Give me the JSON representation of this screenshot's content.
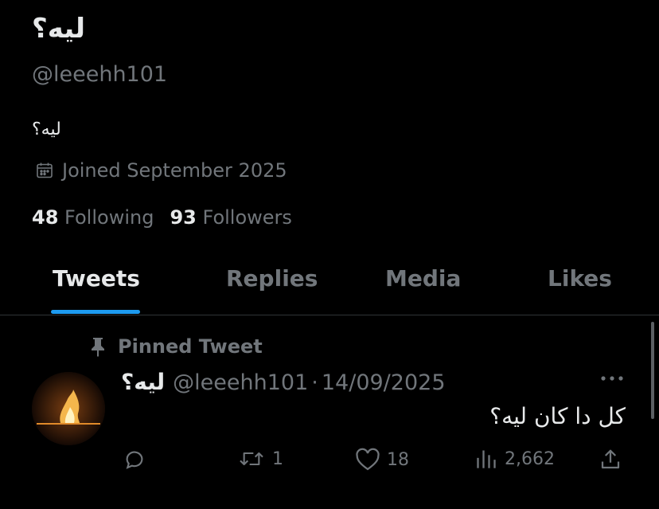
{
  "profile": {
    "display_name": "ليه؟",
    "handle": "@leeehh101",
    "bio": "ليه؟",
    "joined": "Joined September 2025",
    "following_count": "48",
    "following_label": "Following",
    "followers_count": "93",
    "followers_label": "Followers"
  },
  "tabs": [
    {
      "label": "Tweets",
      "active": true
    },
    {
      "label": "Replies",
      "active": false
    },
    {
      "label": "Media",
      "active": false
    },
    {
      "label": "Likes",
      "active": false
    }
  ],
  "pinned_tweet": {
    "pinned_label": "Pinned Tweet",
    "author_name": "ليه؟",
    "author_handle": "@leeehh101",
    "separator": "·",
    "date": "14/09/2025",
    "text": "كل دا كان ليه؟",
    "reply_count": "",
    "retweet_count": "1",
    "like_count": "18",
    "view_count": "2,662"
  },
  "icons": {
    "calendar": "calendar-icon",
    "pin": "pin-icon",
    "more": "more-icon",
    "reply": "reply-icon",
    "retweet": "retweet-icon",
    "like": "heart-icon",
    "views": "views-icon",
    "share": "share-icon"
  },
  "colors": {
    "background": "#000000",
    "text_primary": "#e7e9ea",
    "text_secondary": "#71767b",
    "accent": "#1d9bf0",
    "divider": "#2f3336"
  }
}
